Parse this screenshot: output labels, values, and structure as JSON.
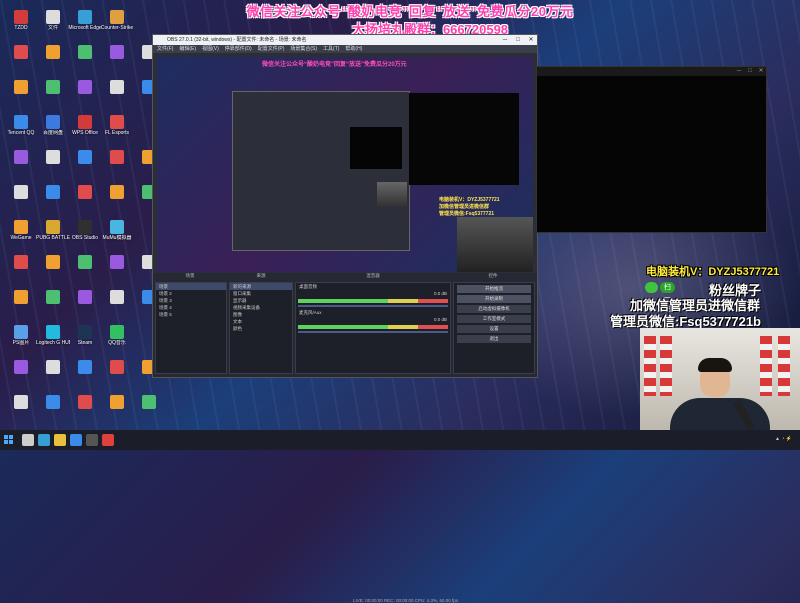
{
  "banner": {
    "line1": "微信关注公众号“酸奶电竞”回复“放送”免费瓜分20万元",
    "line2": "大扬培丸殿群：666720598"
  },
  "desktop_icons": [
    {
      "label": "TZDD",
      "color": "#d43c3c"
    },
    {
      "label": "Tencent QQ",
      "color": "#3b8bea"
    },
    {
      "label": "WeGame",
      "color": "#f0a030"
    },
    {
      "label": "PS图片",
      "color": "#5aa0e8"
    },
    {
      "label": "文件",
      "color": "#dddddd"
    },
    {
      "label": "百度网盘",
      "color": "#3b7be0"
    },
    {
      "label": "PUBG BATTLEGROUNDS",
      "color": "#d8a830"
    },
    {
      "label": "Logitech G HUB",
      "color": "#22bbdd"
    },
    {
      "label": "Microsoft Edge",
      "color": "#36a0d6"
    },
    {
      "label": "WPS Office",
      "color": "#d33b3b"
    },
    {
      "label": "OBS Studio",
      "color": "#303030"
    },
    {
      "label": "Steam",
      "color": "#1c3555"
    },
    {
      "label": "Counter-Strike",
      "color": "#e0a040"
    },
    {
      "label": "FL Esports",
      "color": "#e04c4c"
    },
    {
      "label": "MuMu模拟器",
      "color": "#48b6e0"
    },
    {
      "label": "QQ音乐",
      "color": "#32c060"
    }
  ],
  "obs": {
    "title": "OBS 27.0.1 (32-bit, windows) - 配置文件: 未命名 - 场景: 未命名",
    "menu": [
      "文件(F)",
      "编辑(E)",
      "视图(V)",
      "停靠部件(D)",
      "配置文件(P)",
      "场景集合(S)",
      "工具(T)",
      "帮助(H)"
    ],
    "scene_header": "场景",
    "source_header": "来源",
    "mixer_header": "混音器",
    "controls_header": "控件",
    "scenes": [
      "场景",
      "场景 2",
      "场景 3",
      "场景 4",
      "场景 5"
    ],
    "sources": [
      "新的来源",
      "窗口采集",
      "显示器",
      "视频采集设备",
      "图像",
      "文本",
      "颜色"
    ],
    "mixer": [
      {
        "name": "桌面音频",
        "level": "0.0 dB"
      },
      {
        "name": "麦克风/Aux",
        "level": "0.0 dB"
      }
    ],
    "controls": [
      "开始推流",
      "开始录制",
      "启动虚拟摄像机",
      "工作室模式",
      "设置",
      "退出"
    ],
    "status": "LIVE: 00:00:00   REC: 00:00:00   CPU: 4.3%, 60.00 fps"
  },
  "preview": {
    "banner": "微信关注公众号“酸奶电竞”回复“放送”免费瓜分20万元",
    "wechat_lines": [
      "电脑装机V：DYZJ5377721",
      "加微信管理员进微信群",
      "管理员微信:Fsq5377721"
    ]
  },
  "overlay": {
    "dianao": "电脑装机V：DYZJ5377721",
    "fan_pill": "扫一扫",
    "fans": "粉丝牌子",
    "join": "加微信管理员进微信群",
    "admin": "管理员微信:Fsq5377721b"
  },
  "taskbar_icons": [
    {
      "name": "search",
      "color": "#cccccc"
    },
    {
      "name": "edge",
      "color": "#36a0d6"
    },
    {
      "name": "explorer",
      "color": "#e8c040"
    },
    {
      "name": "qq",
      "color": "#3b8bea"
    },
    {
      "name": "obs",
      "color": "#555555"
    },
    {
      "name": "chrome",
      "color": "#e04040"
    }
  ]
}
